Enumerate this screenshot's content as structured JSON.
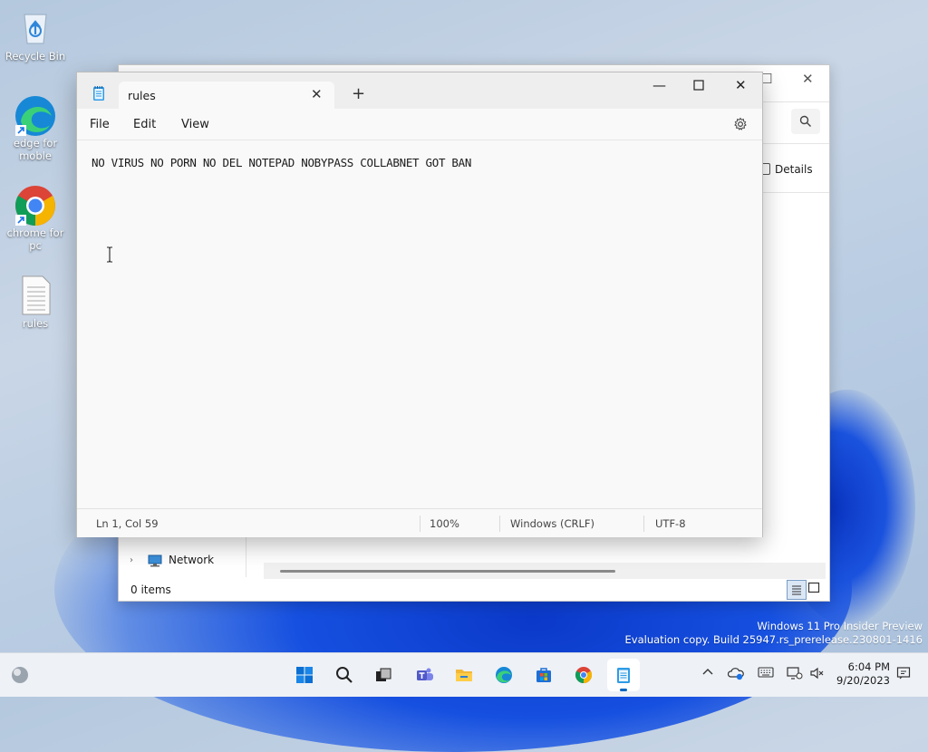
{
  "desktop": {
    "icons": [
      {
        "label": "Recycle Bin"
      },
      {
        "label": "edge for moble"
      },
      {
        "label": "chrome for pc"
      },
      {
        "label": "rules"
      }
    ],
    "watermark": {
      "line1": "Windows 11 Pro Insider Preview",
      "line2": "Evaluation copy. Build 25947.rs_prerelease.230801-1416"
    }
  },
  "explorer": {
    "details_label": "Details",
    "nav_item": "Network",
    "status": "0 items"
  },
  "notepad": {
    "tab_title": "rules",
    "menu": [
      "File",
      "Edit",
      "View"
    ],
    "content": "NO VIRUS NO PORN NO DEL NOTEPAD NOBYPASS COLLABNET GOT BAN",
    "status": {
      "position": "Ln 1, Col 59",
      "zoom": "100%",
      "line_ending": "Windows (CRLF)",
      "encoding": "UTF-8"
    }
  },
  "taskbar": {
    "time": "6:04 PM",
    "date": "9/20/2023"
  },
  "colors": {
    "accent": "#0067c0",
    "wallpaper_blue": "#1650e0"
  }
}
